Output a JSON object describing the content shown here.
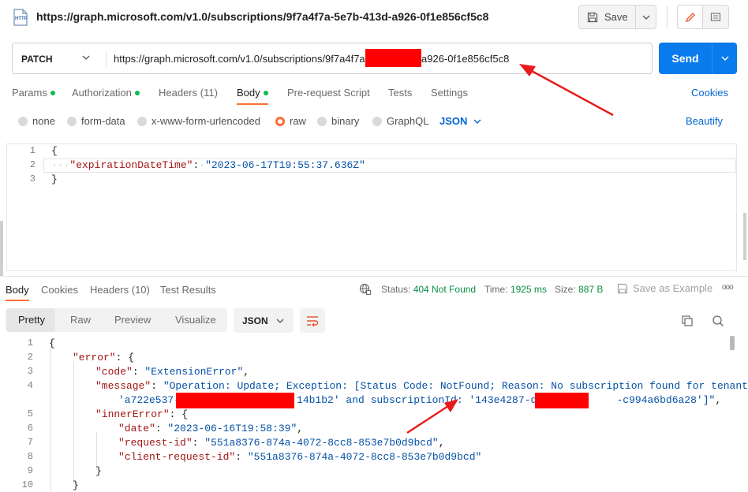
{
  "window": {
    "title": "https://graph.microsoft.com/v1.0/subscriptions/9f7a4f7a-5e7b-413d-a926-0f1e856cf5c8",
    "save_label": "Save",
    "icons": [
      "http-icon",
      "save-icon",
      "chevron-down-icon",
      "edit-icon",
      "comment-icon"
    ]
  },
  "request": {
    "method": "PATCH",
    "url_prefix": "https://graph.microsoft.com/v1.0/subscriptions/9f7a4f7a",
    "url_suffix": "-a926-0f1e856cf5c8",
    "send_label": "Send",
    "tabs": [
      {
        "label": "Params",
        "dot": true
      },
      {
        "label": "Authorization",
        "dot": true
      },
      {
        "label": "Headers (11)",
        "dot": false
      },
      {
        "label": "Body",
        "dot": true,
        "active": true
      },
      {
        "label": "Pre-request Script",
        "dot": false
      },
      {
        "label": "Tests",
        "dot": false
      },
      {
        "label": "Settings",
        "dot": false
      }
    ],
    "cookies_label": "Cookies",
    "body_types": [
      "none",
      "form-data",
      "x-www-form-urlencoded",
      "raw",
      "binary",
      "GraphQL"
    ],
    "selected_body_type": "raw",
    "body_format": "JSON",
    "beautify_label": "Beautify",
    "body_lines": [
      {
        "n": "1",
        "text": "{"
      },
      {
        "n": "2",
        "key": "\"expirationDateTime\"",
        "value": "\"2023-06-17T19:55:37.636Z\""
      },
      {
        "n": "3",
        "text": "}"
      }
    ]
  },
  "response": {
    "tabs": [
      "Body",
      "Cookies",
      "Headers (10)",
      "Test Results"
    ],
    "active_tab": "Body",
    "status_label": "Status:",
    "status_value": "404 Not Found",
    "time_label": "Time:",
    "time_value": "1925 ms",
    "size_label": "Size:",
    "size_value": "887 B",
    "save_example_label": "Save as Example",
    "more_label": "ooo",
    "view_modes": [
      "Pretty",
      "Raw",
      "Preview",
      "Visualize"
    ],
    "active_view": "Pretty",
    "format": "JSON",
    "line_numbers": [
      "1",
      "2",
      "3",
      "4",
      "",
      "5",
      "6",
      "7",
      "8",
      "9",
      "10"
    ],
    "lines": {
      "l1": "{",
      "l2_key": "\"error\"",
      "l2_rest": ": {",
      "l3_key": "\"code\"",
      "l3_val": "\"ExtensionError\"",
      "l4_key": "\"message\"",
      "l4_val": "\"Operation: Update; Exception: [Status Code: NotFound; Reason: No subscription found for tenantId:",
      "l4b_part1": "'a722e537-",
      "l4b_part2": "14b1b2' and subscriptionId: '143e4287-d1cd-",
      "l4b_part3": "-c994a6bd6a28']\"",
      "l5_key": "\"innerError\"",
      "l5_rest": ": {",
      "l6_key": "\"date\"",
      "l6_val": "\"2023-06-16T19:58:39\"",
      "l7_key": "\"request-id\"",
      "l7_val": "\"551a8376-874a-4072-8cc8-853e7b0d9bcd\"",
      "l8_key": "\"client-request-id\"",
      "l8_val": "\"551a8376-874a-4072-8cc8-853e7b0d9bcd\"",
      "l9": "}",
      "l10": "}"
    }
  },
  "colors": {
    "accent": "#ff6c37",
    "send": "#097bed",
    "link": "#0265d2",
    "status_ok_dot": "#0cbb52",
    "status_text": "#0a8f43",
    "annotation_arrow": "#e81c1c",
    "redaction": "#ff0000"
  }
}
